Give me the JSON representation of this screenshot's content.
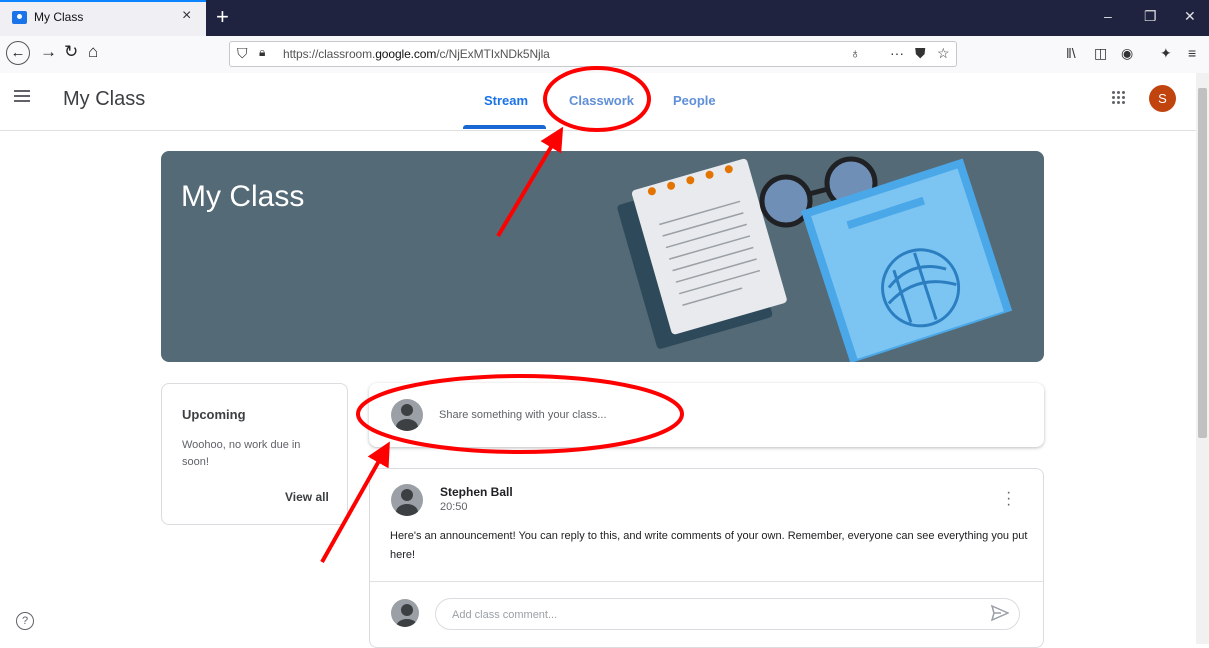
{
  "browser": {
    "tab_title": "My Class",
    "tab_close": "×",
    "new_tab": "+",
    "url_prefix": "https://classroom.",
    "url_domain": "google.com",
    "url_path": "/c/NjExMTIxNDk5Njla",
    "window_controls": [
      "–",
      "❐",
      "✕"
    ]
  },
  "header": {
    "class_name": "My Class",
    "tabs": [
      {
        "label": "Stream",
        "active": true
      },
      {
        "label": "Classwork",
        "active": false
      },
      {
        "label": "People",
        "active": false
      }
    ],
    "avatar_letter": "S"
  },
  "banner": {
    "title": "My Class",
    "color": "#546a76"
  },
  "upcoming": {
    "title": "Upcoming",
    "text": "Woohoo, no work due in soon!",
    "view_all": "View all"
  },
  "share": {
    "placeholder": "Share something with your class..."
  },
  "post": {
    "author": "Stephen Ball",
    "time": "20:50",
    "text": "Here's an announcement! You can reply to this, and write comments of your own. Remember, everyone can see everything you put here!",
    "comment_placeholder": "Add class comment..."
  },
  "colors": {
    "accent": "#1a73e8",
    "annotation": "#ff0000",
    "avatar": "#c1440e"
  },
  "icons": [
    "back-icon",
    "forward-icon",
    "reload-icon",
    "home-icon",
    "shield-icon",
    "lock-icon",
    "bulb-icon",
    "more-icon",
    "pocket-icon",
    "star-icon",
    "library-icon",
    "sidebar-icon",
    "account-icon",
    "extension-icon",
    "menu-icon",
    "apps-icon",
    "help-icon",
    "send-icon",
    "kebab-icon"
  ]
}
